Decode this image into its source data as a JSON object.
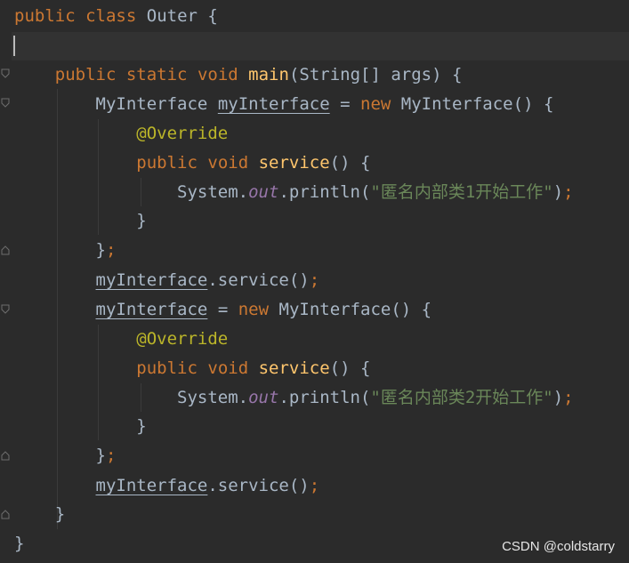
{
  "code": {
    "l1": {
      "kw1": "public",
      "kw2": "class",
      "name": "Outer",
      "brace": "{"
    },
    "l3": {
      "kw1": "public",
      "kw2": "static",
      "kw3": "void",
      "fn": "main",
      "params": "(String[] args) {"
    },
    "l4": {
      "type": "MyInterface",
      "var": "myInterface",
      "eq": "=",
      "kw": "new",
      "ctor": "MyInterface() {"
    },
    "l5": {
      "ann": "@Override"
    },
    "l6": {
      "kw1": "public",
      "kw2": "void",
      "fn": "service",
      "rest": "() {"
    },
    "l7": {
      "cls": "System.",
      "field": "out",
      "call": ".println(",
      "str": "\"匿名内部类1开始工作\"",
      "end": ")",
      "semi": ";"
    },
    "l8": {
      "brace": "}"
    },
    "l9": {
      "brace": "}",
      "semi": ";"
    },
    "l10": {
      "var": "myInterface",
      "call": ".service()",
      "semi": ";"
    },
    "l11": {
      "var": "myInterface",
      "eq": "=",
      "kw": "new",
      "ctor": "MyInterface() {"
    },
    "l12": {
      "ann": "@Override"
    },
    "l13": {
      "kw1": "public",
      "kw2": "void",
      "fn": "service",
      "rest": "() {"
    },
    "l14": {
      "cls": "System.",
      "field": "out",
      "call": ".println(",
      "str": "\"匿名内部类2开始工作\"",
      "end": ")",
      "semi": ";"
    },
    "l15": {
      "brace": "}"
    },
    "l16": {
      "brace": "}",
      "semi": ";"
    },
    "l17": {
      "var": "myInterface",
      "call": ".service()",
      "semi": ";"
    },
    "l18": {
      "brace": "}"
    },
    "l19": {
      "brace": "}"
    }
  },
  "watermark": "CSDN @coldstarry",
  "colors": {
    "background": "#2b2b2b",
    "keyword": "#cc7832",
    "function": "#ffc66d",
    "annotation": "#bbb529",
    "string": "#6a8759",
    "field": "#9876aa",
    "text": "#a9b7c6"
  }
}
